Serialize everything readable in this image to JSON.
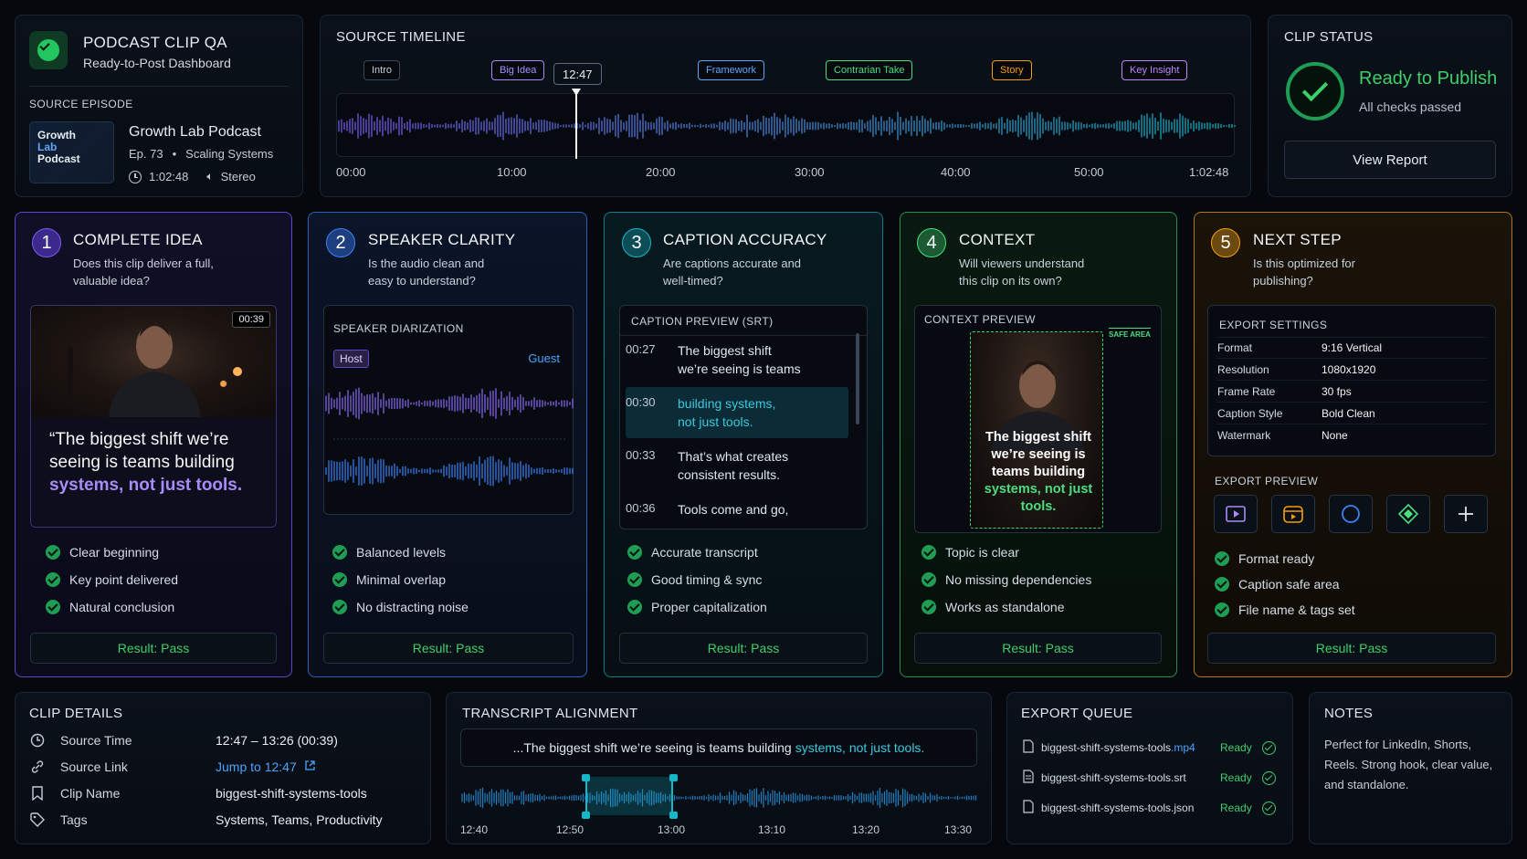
{
  "header": {
    "app_title": "PODCAST CLIP QA",
    "app_subtitle": "Ready-to-Post Dashboard",
    "source_episode_label": "SOURCE EPISODE",
    "podcast_thumb_text": [
      "Growth",
      "Lab",
      "Podcast"
    ],
    "podcast_name": "Growth Lab Podcast",
    "episode_number": "Ep. 73",
    "episode_title": "Scaling Systems",
    "duration": "1:02:48",
    "audio": "Stereo"
  },
  "timeline": {
    "title": "SOURCE TIMELINE",
    "markers": [
      {
        "label": "Intro",
        "color": "#9aa7b6"
      },
      {
        "label": "Big Idea",
        "color": "#a78bfa"
      },
      {
        "label": "Framework",
        "color": "#60a5fa"
      },
      {
        "label": "Contrarian Take",
        "color": "#4ade80"
      },
      {
        "label": "Story",
        "color": "#f59e0b"
      },
      {
        "label": "Key Insight",
        "color": "#c084fc"
      }
    ],
    "playhead_time": "12:47",
    "ticks": [
      "00:00",
      "10:00",
      "20:00",
      "30:00",
      "40:00",
      "50:00",
      "1:02:48"
    ]
  },
  "clip_status": {
    "title": "CLIP STATUS",
    "status": "Ready to Publish",
    "detail": "All checks passed",
    "button": "View Report"
  },
  "steps": [
    {
      "num": "1",
      "title": "COMPLETE IDEA",
      "question": [
        "Does this clip deliver a full,",
        "valuable idea?"
      ],
      "video_time": "00:39",
      "quote_start": "“The biggest shift we’re seeing is teams building ",
      "quote_highlight": "systems, not just tools.",
      "checks": [
        "Clear beginning",
        "Key point delivered",
        "Natural conclusion"
      ],
      "result": "Result: Pass"
    },
    {
      "num": "2",
      "title": "SPEAKER CLARITY",
      "question": [
        "Is the audio clean and",
        "easy to understand?"
      ],
      "panel_label": "SPEAKER DIARIZATION",
      "speaker_a": "Host",
      "speaker_b": "Guest",
      "checks": [
        "Balanced levels",
        "Minimal overlap",
        "No distracting noise"
      ],
      "result": "Result: Pass"
    },
    {
      "num": "3",
      "title": "CAPTION ACCURACY",
      "question": [
        "Are captions accurate and",
        "well-timed?"
      ],
      "panel_label": "CAPTION PREVIEW (SRT)",
      "captions": [
        {
          "time": "00:27",
          "text": [
            "The biggest shift",
            "we’re seeing is teams"
          ]
        },
        {
          "time": "00:30",
          "text": [
            "building systems,",
            "not just tools."
          ]
        },
        {
          "time": "00:33",
          "text": [
            "That’s what creates",
            "consistent results."
          ]
        },
        {
          "time": "00:36",
          "text": [
            "Tools come and go,"
          ]
        }
      ],
      "checks": [
        "Accurate transcript",
        "Good timing & sync",
        "Proper capitalization"
      ],
      "result": "Result: Pass"
    },
    {
      "num": "4",
      "title": "CONTEXT",
      "question": [
        "Will viewers understand",
        "this clip on its own?"
      ],
      "panel_label": "CONTEXT PREVIEW",
      "safe_area": "SAFE AREA",
      "overlay_start": "The biggest shift we’re seeing is teams building ",
      "overlay_highlight": "systems, not just tools.",
      "checks": [
        "Topic is clear",
        "No missing dependencies",
        "Works as standalone"
      ],
      "result": "Result: Pass"
    },
    {
      "num": "5",
      "title": "NEXT STEP",
      "question": [
        "Is this optimized for",
        "publishing?"
      ],
      "panel_label": "EXPORT SETTINGS",
      "settings": [
        {
          "k": "Format",
          "v": "9:16 Vertical"
        },
        {
          "k": "Resolution",
          "v": "1080x1920"
        },
        {
          "k": "Frame Rate",
          "v": "30 fps"
        },
        {
          "k": "Caption Style",
          "v": "Bold Clean"
        },
        {
          "k": "Watermark",
          "v": "None"
        }
      ],
      "preview_label": "EXPORT PREVIEW",
      "checks": [
        "Format ready",
        "Caption safe area",
        "File name & tags set"
      ],
      "result": "Result: Pass"
    }
  ],
  "clip_details": {
    "title": "CLIP DETAILS",
    "rows": [
      {
        "k": "Source Time",
        "v": "12:47 – 13:26 (00:39)"
      },
      {
        "k": "Source Link",
        "v": "Jump to 12:47"
      },
      {
        "k": "Clip Name",
        "v": "biggest-shift-systems-tools"
      },
      {
        "k": "Tags",
        "v": "Systems, Teams, Productivity"
      }
    ]
  },
  "transcript": {
    "title": "TRANSCRIPT ALIGNMENT",
    "text_start": "...The biggest shift we’re seeing is teams building ",
    "text_highlight": "systems, not just tools.",
    "ticks": [
      "12:40",
      "12:50",
      "13:00",
      "13:10",
      "13:20",
      "13:30"
    ]
  },
  "export_queue": {
    "title": "EXPORT QUEUE",
    "files": [
      {
        "base": "biggest-shift-systems-tools",
        "ext": ".mp4",
        "status": "Ready"
      },
      {
        "base": "biggest-shift-systems-tools",
        "ext": ".srt",
        "status": "Ready"
      },
      {
        "base": "biggest-shift-systems-tools",
        "ext": ".json",
        "status": "Ready"
      }
    ]
  },
  "notes": {
    "title": "NOTES",
    "text": "Perfect for LinkedIn, Shorts, Reels. Strong hook, clear value, and standalone."
  },
  "colors": {
    "pass_green": "#3ecf6a",
    "step1": "#7c5cf0",
    "step2": "#3b82f6",
    "step3": "#14b8c8",
    "step4": "#4ade80",
    "step5": "#f59e0b"
  }
}
